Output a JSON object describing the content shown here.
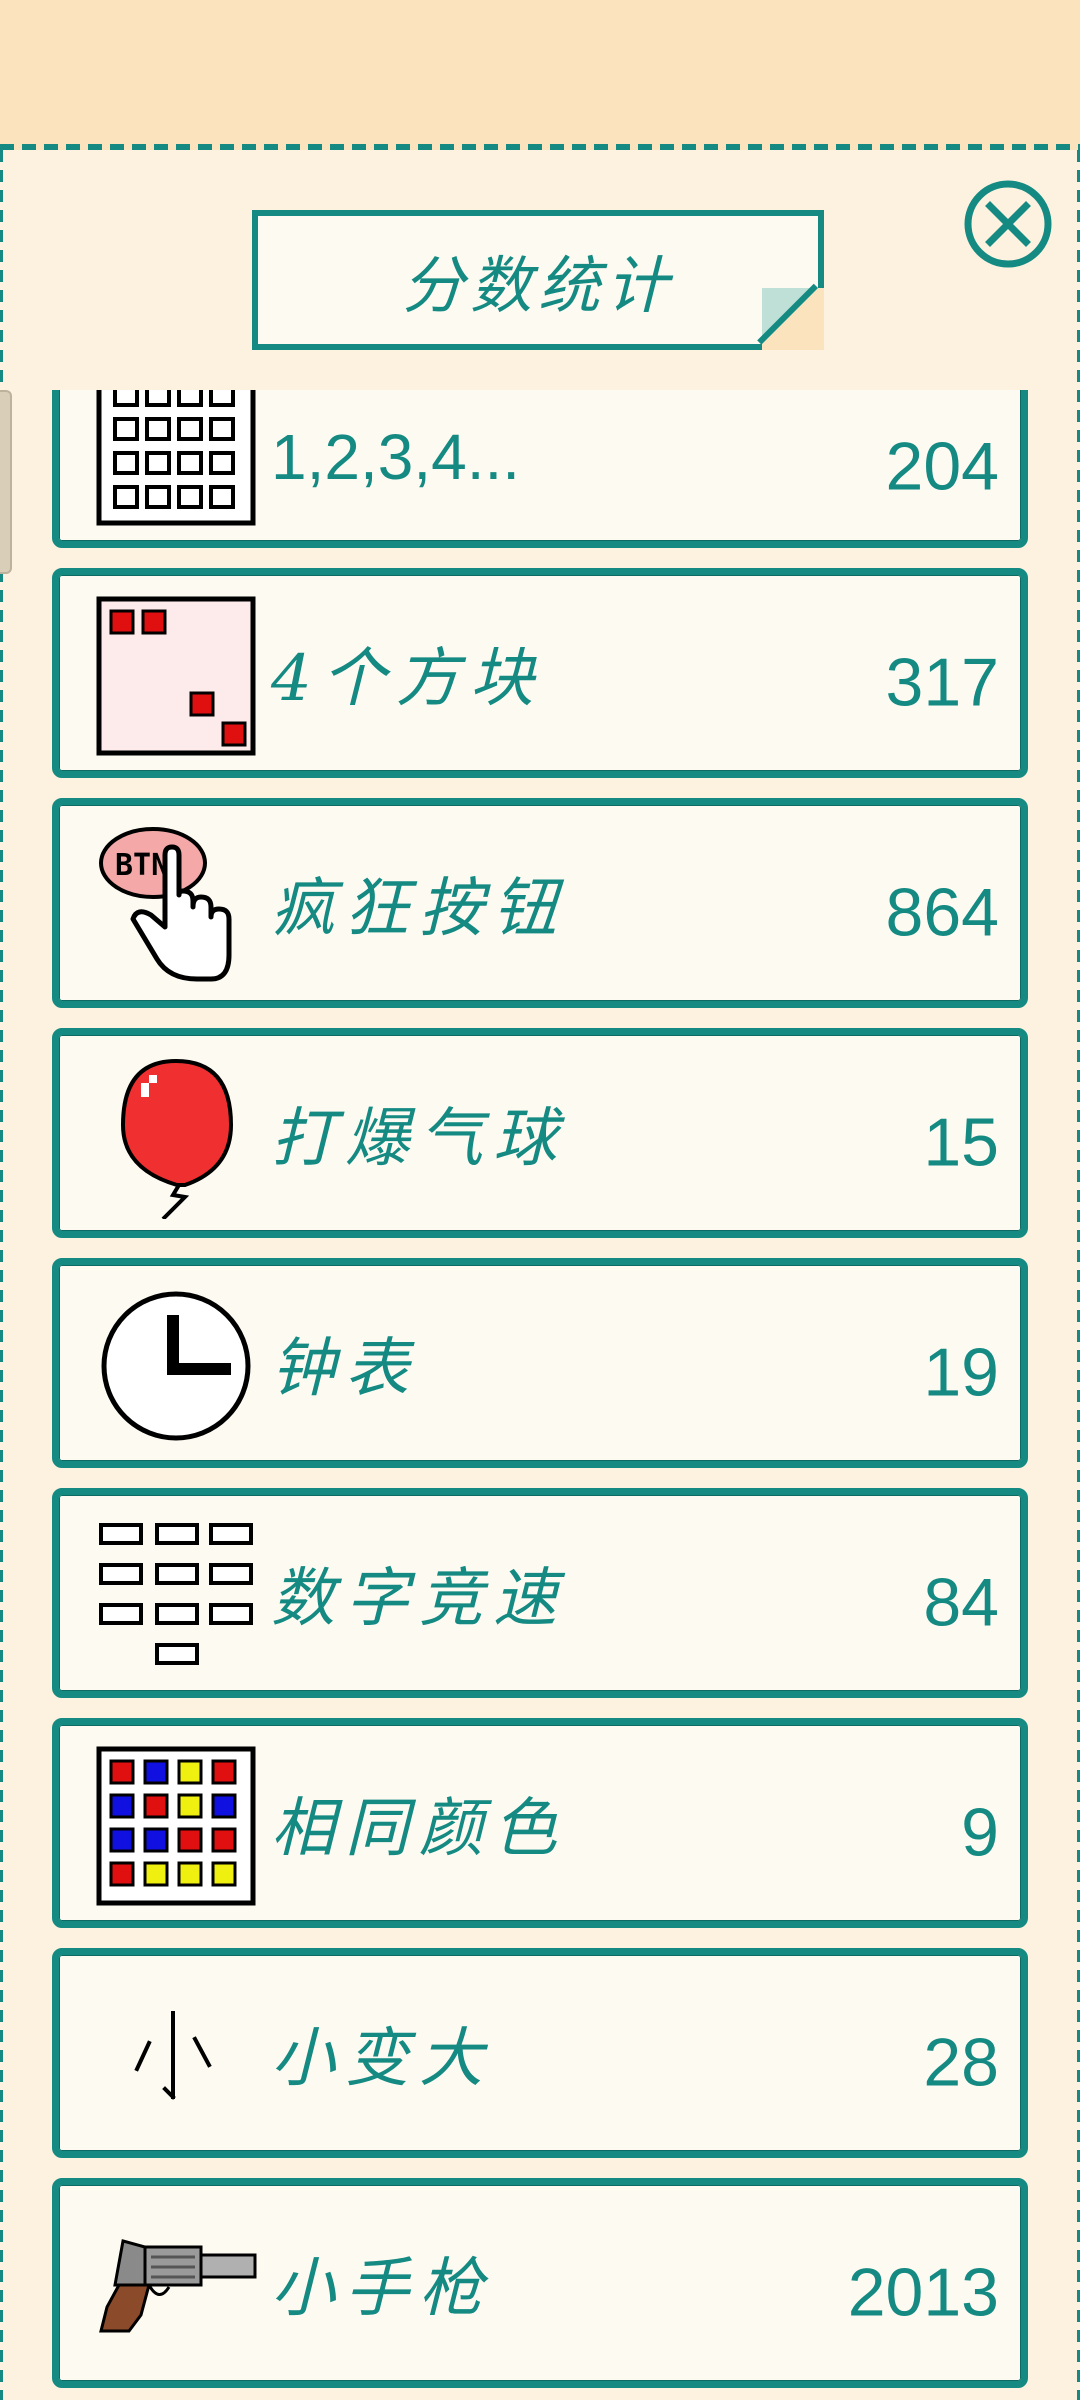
{
  "title": "分数统计",
  "close_icon": "close-circle-x-icon",
  "colors": {
    "accent": "#148a82",
    "background": "#fae3bd",
    "panel": "#fdf2e0",
    "card": "#fdfaf2"
  },
  "items": [
    {
      "name": "1,2,3,4...",
      "score": "204",
      "icon": "number-grid-icon"
    },
    {
      "name": "4个方块",
      "score": "317",
      "icon": "four-blocks-icon"
    },
    {
      "name": "疯狂按钮",
      "score": "864",
      "icon": "btn-press-icon"
    },
    {
      "name": "打爆气球",
      "score": "15",
      "icon": "balloon-icon"
    },
    {
      "name": "钟表",
      "score": "19",
      "icon": "clock-icon"
    },
    {
      "name": "数字竞速",
      "score": "84",
      "icon": "number-race-icon"
    },
    {
      "name": "相同颜色",
      "score": "9",
      "icon": "color-grid-icon"
    },
    {
      "name": "小变大",
      "score": "28",
      "icon": "small-to-big-icon"
    },
    {
      "name": "小手枪",
      "score": "2013",
      "icon": "revolver-icon"
    }
  ]
}
